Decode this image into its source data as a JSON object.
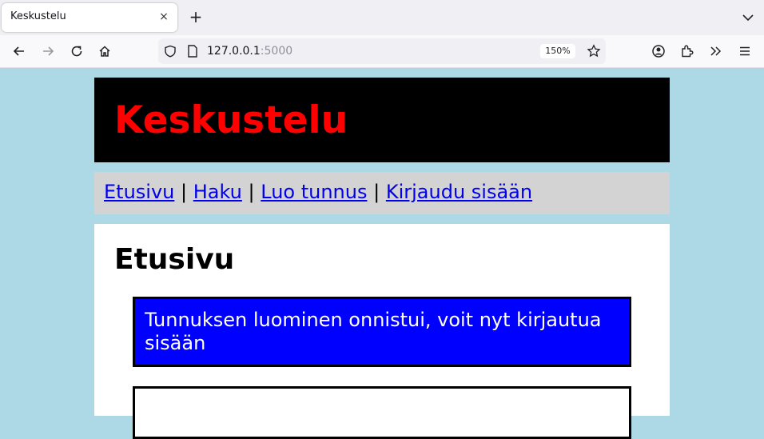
{
  "browser": {
    "tab_title": "Keskustelu",
    "tab_close_glyph": "×",
    "new_tab_glyph": "+",
    "url_host": "127.0.0.1",
    "url_port": ":5000",
    "zoom": "150%"
  },
  "site": {
    "title": "Keskustelu",
    "title_color": "#ff0000",
    "header_bg": "#000000",
    "page_bg": "#add8e6"
  },
  "nav": {
    "items": [
      {
        "label": "Etusivu"
      },
      {
        "label": "Haku"
      },
      {
        "label": "Luo tunnus"
      },
      {
        "label": "Kirjaudu sisään"
      }
    ],
    "separator": "|",
    "link_color": "#0000ee"
  },
  "main": {
    "heading": "Etusivu",
    "flash_message": "Tunnuksen luominen onnistui, voit nyt kirjautua sisään",
    "flash_bg": "#0000ff"
  }
}
